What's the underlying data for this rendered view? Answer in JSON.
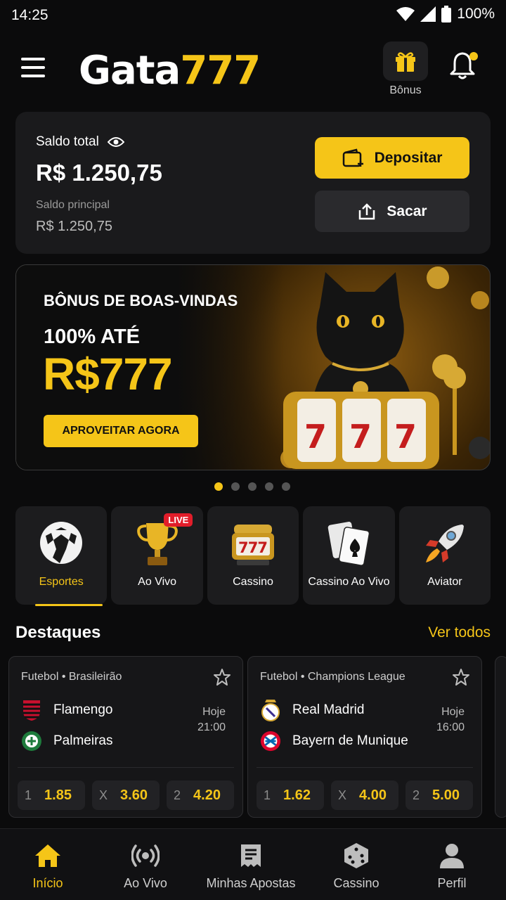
{
  "status_bar": {
    "time": "14:25",
    "battery": "100%"
  },
  "header": {
    "logo_white": "Gata",
    "logo_yellow": "777",
    "bonus_label": "Bônus"
  },
  "balance": {
    "title": "Saldo total",
    "amount": "R$ 1.250,75",
    "sub_label": "Saldo principal",
    "sub_amount": "R$ 1.250,75",
    "deposit_label": "Depositar",
    "withdraw_label": "Sacar"
  },
  "banner": {
    "title": "BÔNUS DE BOAS-VINDAS",
    "line1": "100% ATÉ",
    "line2": "R$777",
    "cta": "APROVEITAR AGORA",
    "reel": "777",
    "slide_count": 5,
    "active_slide": 1
  },
  "categories": [
    {
      "label": "Esportes",
      "icon": "soccer-ball-icon",
      "active": true
    },
    {
      "label": "Ao Vivo",
      "icon": "trophy-icon",
      "badge": "LIVE"
    },
    {
      "label": "Cassino",
      "icon": "slot-machine-icon",
      "reel": "777"
    },
    {
      "label": "Cassino Ao Vivo",
      "icon": "playing-cards-icon"
    },
    {
      "label": "Aviator",
      "icon": "rocket-icon"
    }
  ],
  "highlights": {
    "title": "Destaques",
    "see_all": "Ver todos",
    "matches": [
      {
        "league": "Futebol • Brasileirão",
        "home": "Flamengo",
        "away": "Palmeiras",
        "day": "Hoje",
        "time": "21:00",
        "odds": [
          {
            "k": "1",
            "v": "1.85"
          },
          {
            "k": "X",
            "v": "3.60"
          },
          {
            "k": "2",
            "v": "4.20"
          }
        ]
      },
      {
        "league": "Futebol • Champions League",
        "home": "Real Madrid",
        "away": "Bayern de Munique",
        "day": "Hoje",
        "time": "16:00",
        "odds": [
          {
            "k": "1",
            "v": "1.62"
          },
          {
            "k": "X",
            "v": "4.00"
          },
          {
            "k": "2",
            "v": "5.00"
          }
        ]
      }
    ]
  },
  "bottom_nav": [
    {
      "label": "Início",
      "icon": "home-icon",
      "active": true
    },
    {
      "label": "Ao Vivo",
      "icon": "broadcast-icon"
    },
    {
      "label": "Minhas Apostas",
      "icon": "receipt-icon"
    },
    {
      "label": "Cassino",
      "icon": "dice-icon"
    },
    {
      "label": "Perfil",
      "icon": "user-icon"
    }
  ],
  "colors": {
    "accent": "#f5c518",
    "background": "#0b0b0c",
    "card": "#1a1a1c",
    "live": "#e11d2a"
  }
}
